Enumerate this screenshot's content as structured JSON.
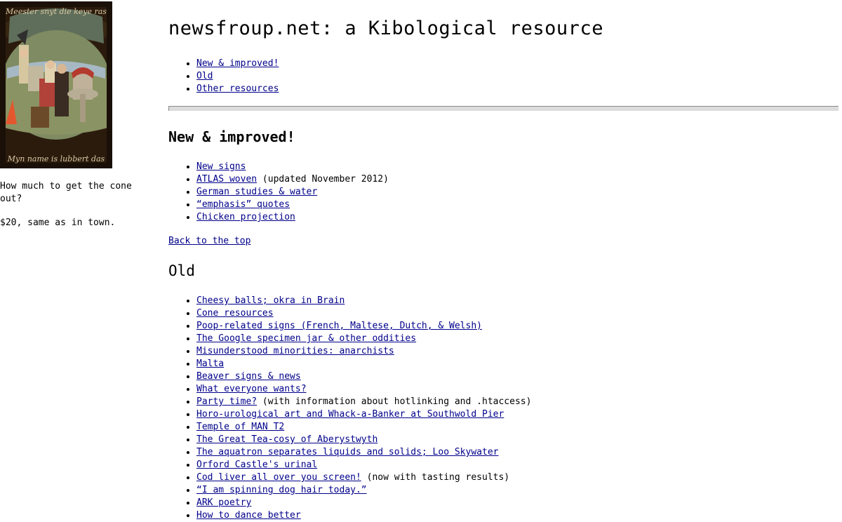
{
  "sidebar": {
    "painting_text_top": "Meester snyt die keye ras",
    "painting_text_bottom": "Myn name is lubbert das",
    "question": "How much to get the cone out?",
    "answer": "$20, same as in town."
  },
  "header": {
    "title": "newsfroup.net: a Kibological resource"
  },
  "toc": [
    {
      "label": "New & improved!"
    },
    {
      "label": "Old"
    },
    {
      "label": "Other resources"
    }
  ],
  "new_section": {
    "heading": "New & improved!",
    "items": [
      {
        "label": "New signs",
        "note": ""
      },
      {
        "label": "ATLAS woven",
        "note": " (updated November 2012)"
      },
      {
        "label": "German studies & water",
        "note": ""
      },
      {
        "label": "“emphasis” quotes",
        "note": ""
      },
      {
        "label": "Chicken projection",
        "note": ""
      }
    ],
    "back_to_top": "Back to the top"
  },
  "old_section": {
    "heading": "Old",
    "items": [
      {
        "label": "Cheesy balls; okra in Brain",
        "note": ""
      },
      {
        "label": "Cone resources",
        "note": ""
      },
      {
        "label": "Poop-related signs (French, Maltese, Dutch, & Welsh)",
        "note": ""
      },
      {
        "label": "The Google specimen jar & other oddities",
        "note": ""
      },
      {
        "label": "Misunderstood minorities: anarchists",
        "note": ""
      },
      {
        "label": "Malta",
        "note": ""
      },
      {
        "label": "Beaver signs & news",
        "note": ""
      },
      {
        "label": "What everyone wants?",
        "note": ""
      },
      {
        "label": "Party time?",
        "note": " (with information about hotlinking and .htaccess)"
      },
      {
        "label": "Horo-urological art and Whack-a-Banker at Southwold Pier",
        "note": ""
      },
      {
        "label": "Temple of MAN T2",
        "note": ""
      },
      {
        "label": "The Great Tea-cosy of Aberystwyth",
        "note": ""
      },
      {
        "label": "The aquatron separates liquids and solids; Loo Skywater",
        "note": ""
      },
      {
        "label": "Orford Castle's urinal",
        "note": ""
      },
      {
        "label": "Cod liver all over you screen!",
        "note": " (now with tasting results)"
      },
      {
        "label": "“I am spinning dog hair today.”",
        "note": ""
      },
      {
        "label": "ARK poetry",
        "note": ""
      },
      {
        "label": "How to dance better",
        "note": ""
      }
    ]
  },
  "colors": {
    "link": "#00008b",
    "background": "#ffffff",
    "rule": "#dcdcdc"
  }
}
